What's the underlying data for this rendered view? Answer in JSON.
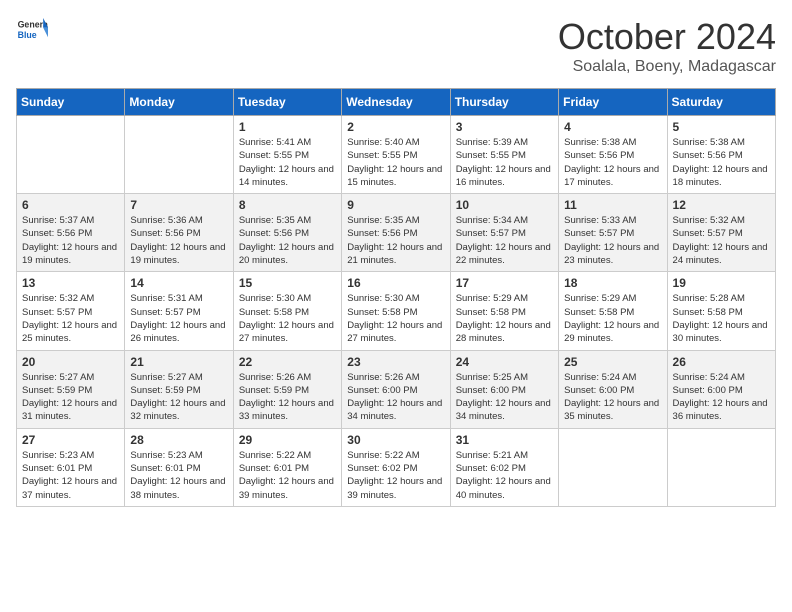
{
  "header": {
    "logo_general": "General",
    "logo_blue": "Blue",
    "month": "October 2024",
    "location": "Soalala, Boeny, Madagascar"
  },
  "days_of_week": [
    "Sunday",
    "Monday",
    "Tuesday",
    "Wednesday",
    "Thursday",
    "Friday",
    "Saturday"
  ],
  "weeks": [
    [
      {
        "day": "",
        "sunrise": "",
        "sunset": "",
        "daylight": ""
      },
      {
        "day": "",
        "sunrise": "",
        "sunset": "",
        "daylight": ""
      },
      {
        "day": "1",
        "sunrise": "Sunrise: 5:41 AM",
        "sunset": "Sunset: 5:55 PM",
        "daylight": "Daylight: 12 hours and 14 minutes."
      },
      {
        "day": "2",
        "sunrise": "Sunrise: 5:40 AM",
        "sunset": "Sunset: 5:55 PM",
        "daylight": "Daylight: 12 hours and 15 minutes."
      },
      {
        "day": "3",
        "sunrise": "Sunrise: 5:39 AM",
        "sunset": "Sunset: 5:55 PM",
        "daylight": "Daylight: 12 hours and 16 minutes."
      },
      {
        "day": "4",
        "sunrise": "Sunrise: 5:38 AM",
        "sunset": "Sunset: 5:56 PM",
        "daylight": "Daylight: 12 hours and 17 minutes."
      },
      {
        "day": "5",
        "sunrise": "Sunrise: 5:38 AM",
        "sunset": "Sunset: 5:56 PM",
        "daylight": "Daylight: 12 hours and 18 minutes."
      }
    ],
    [
      {
        "day": "6",
        "sunrise": "Sunrise: 5:37 AM",
        "sunset": "Sunset: 5:56 PM",
        "daylight": "Daylight: 12 hours and 19 minutes."
      },
      {
        "day": "7",
        "sunrise": "Sunrise: 5:36 AM",
        "sunset": "Sunset: 5:56 PM",
        "daylight": "Daylight: 12 hours and 19 minutes."
      },
      {
        "day": "8",
        "sunrise": "Sunrise: 5:35 AM",
        "sunset": "Sunset: 5:56 PM",
        "daylight": "Daylight: 12 hours and 20 minutes."
      },
      {
        "day": "9",
        "sunrise": "Sunrise: 5:35 AM",
        "sunset": "Sunset: 5:56 PM",
        "daylight": "Daylight: 12 hours and 21 minutes."
      },
      {
        "day": "10",
        "sunrise": "Sunrise: 5:34 AM",
        "sunset": "Sunset: 5:57 PM",
        "daylight": "Daylight: 12 hours and 22 minutes."
      },
      {
        "day": "11",
        "sunrise": "Sunrise: 5:33 AM",
        "sunset": "Sunset: 5:57 PM",
        "daylight": "Daylight: 12 hours and 23 minutes."
      },
      {
        "day": "12",
        "sunrise": "Sunrise: 5:32 AM",
        "sunset": "Sunset: 5:57 PM",
        "daylight": "Daylight: 12 hours and 24 minutes."
      }
    ],
    [
      {
        "day": "13",
        "sunrise": "Sunrise: 5:32 AM",
        "sunset": "Sunset: 5:57 PM",
        "daylight": "Daylight: 12 hours and 25 minutes."
      },
      {
        "day": "14",
        "sunrise": "Sunrise: 5:31 AM",
        "sunset": "Sunset: 5:57 PM",
        "daylight": "Daylight: 12 hours and 26 minutes."
      },
      {
        "day": "15",
        "sunrise": "Sunrise: 5:30 AM",
        "sunset": "Sunset: 5:58 PM",
        "daylight": "Daylight: 12 hours and 27 minutes."
      },
      {
        "day": "16",
        "sunrise": "Sunrise: 5:30 AM",
        "sunset": "Sunset: 5:58 PM",
        "daylight": "Daylight: 12 hours and 27 minutes."
      },
      {
        "day": "17",
        "sunrise": "Sunrise: 5:29 AM",
        "sunset": "Sunset: 5:58 PM",
        "daylight": "Daylight: 12 hours and 28 minutes."
      },
      {
        "day": "18",
        "sunrise": "Sunrise: 5:29 AM",
        "sunset": "Sunset: 5:58 PM",
        "daylight": "Daylight: 12 hours and 29 minutes."
      },
      {
        "day": "19",
        "sunrise": "Sunrise: 5:28 AM",
        "sunset": "Sunset: 5:58 PM",
        "daylight": "Daylight: 12 hours and 30 minutes."
      }
    ],
    [
      {
        "day": "20",
        "sunrise": "Sunrise: 5:27 AM",
        "sunset": "Sunset: 5:59 PM",
        "daylight": "Daylight: 12 hours and 31 minutes."
      },
      {
        "day": "21",
        "sunrise": "Sunrise: 5:27 AM",
        "sunset": "Sunset: 5:59 PM",
        "daylight": "Daylight: 12 hours and 32 minutes."
      },
      {
        "day": "22",
        "sunrise": "Sunrise: 5:26 AM",
        "sunset": "Sunset: 5:59 PM",
        "daylight": "Daylight: 12 hours and 33 minutes."
      },
      {
        "day": "23",
        "sunrise": "Sunrise: 5:26 AM",
        "sunset": "Sunset: 6:00 PM",
        "daylight": "Daylight: 12 hours and 34 minutes."
      },
      {
        "day": "24",
        "sunrise": "Sunrise: 5:25 AM",
        "sunset": "Sunset: 6:00 PM",
        "daylight": "Daylight: 12 hours and 34 minutes."
      },
      {
        "day": "25",
        "sunrise": "Sunrise: 5:24 AM",
        "sunset": "Sunset: 6:00 PM",
        "daylight": "Daylight: 12 hours and 35 minutes."
      },
      {
        "day": "26",
        "sunrise": "Sunrise: 5:24 AM",
        "sunset": "Sunset: 6:00 PM",
        "daylight": "Daylight: 12 hours and 36 minutes."
      }
    ],
    [
      {
        "day": "27",
        "sunrise": "Sunrise: 5:23 AM",
        "sunset": "Sunset: 6:01 PM",
        "daylight": "Daylight: 12 hours and 37 minutes."
      },
      {
        "day": "28",
        "sunrise": "Sunrise: 5:23 AM",
        "sunset": "Sunset: 6:01 PM",
        "daylight": "Daylight: 12 hours and 38 minutes."
      },
      {
        "day": "29",
        "sunrise": "Sunrise: 5:22 AM",
        "sunset": "Sunset: 6:01 PM",
        "daylight": "Daylight: 12 hours and 39 minutes."
      },
      {
        "day": "30",
        "sunrise": "Sunrise: 5:22 AM",
        "sunset": "Sunset: 6:02 PM",
        "daylight": "Daylight: 12 hours and 39 minutes."
      },
      {
        "day": "31",
        "sunrise": "Sunrise: 5:21 AM",
        "sunset": "Sunset: 6:02 PM",
        "daylight": "Daylight: 12 hours and 40 minutes."
      },
      {
        "day": "",
        "sunrise": "",
        "sunset": "",
        "daylight": ""
      },
      {
        "day": "",
        "sunrise": "",
        "sunset": "",
        "daylight": ""
      }
    ]
  ]
}
